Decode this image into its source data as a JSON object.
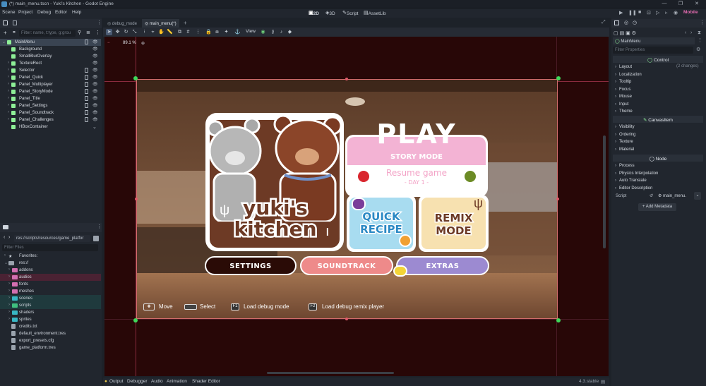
{
  "titlebar": {
    "title": "(*) main_menu.tscn - Yuki's Kitchen - Godot Engine",
    "controls": [
      "—",
      "❐",
      "✕"
    ]
  },
  "menus": [
    "Scene",
    "Project",
    "Debug",
    "Editor",
    "Help"
  ],
  "workspaces": {
    "w2d": "2D",
    "w3d": "3D",
    "script": "Script",
    "assetlib": "AssetLib"
  },
  "renderer": "Mobile",
  "scene_dock": {
    "filter_placeholder": "Filter: name, t:type, g:grou",
    "nodes": [
      {
        "name": "MainMenu",
        "color": "#8eef97"
      },
      {
        "name": "Background",
        "color": "#8eef97"
      },
      {
        "name": "SmallBlurOverlay",
        "color": "#8eef97"
      },
      {
        "name": "TextureRect",
        "color": "#8eef97"
      },
      {
        "name": "Selector",
        "color": "#8eef97"
      },
      {
        "name": "Panel_Quick",
        "color": "#8eef97"
      },
      {
        "name": "Panel_Multiplayer",
        "color": "#8eef97"
      },
      {
        "name": "Panel_StoryMode",
        "color": "#8eef97"
      },
      {
        "name": "Panel_Title",
        "color": "#8eef97"
      },
      {
        "name": "Panel_Settings",
        "color": "#8eef97"
      },
      {
        "name": "Panel_Soundtrack",
        "color": "#8eef97"
      },
      {
        "name": "Panel_Challenges",
        "color": "#8eef97"
      },
      {
        "name": "HBoxContainer",
        "color": "#8eef97"
      }
    ]
  },
  "filesystem": {
    "path": "res://scripts/resources/game_platfor",
    "filter_placeholder": "Filter Files",
    "favorites": "Favorites:",
    "root": "res://",
    "folders": [
      {
        "name": "addons",
        "color": "#d46fb1"
      },
      {
        "name": "audios",
        "color": "#d46fb1"
      },
      {
        "name": "fonts",
        "color": "#d46fb1"
      },
      {
        "name": "meshes",
        "color": "#d46fb1"
      },
      {
        "name": "scenes",
        "color": "#38b6c4"
      },
      {
        "name": "scripts",
        "color": "#3fbf7f"
      },
      {
        "name": "shaders",
        "color": "#38b6c4"
      },
      {
        "name": "sprites",
        "color": "#38b6c4"
      }
    ],
    "files": [
      "credits.txt",
      "default_environment.tres",
      "export_presets.cfg",
      "game_platform.tres"
    ]
  },
  "tabs": [
    "debug_mode",
    "main_menu(*)"
  ],
  "viewport": {
    "zoom": "89.1 %",
    "view_menu": "View"
  },
  "game": {
    "logo_line1": "yuki's",
    "logo_line2": "kitchen",
    "play": "PLAY",
    "story_mode": "STORY MODE",
    "resume": "Resume game",
    "day": "- DAY 1 -",
    "quick": "QUICK",
    "recipe": "RECIPE",
    "remix": "REMIX",
    "mode": "MODE",
    "settings": "SETTINGS",
    "soundtrack": "SOUNDTRACK",
    "extras": "EXTRAS",
    "hints": [
      {
        "key": "",
        "label": "Move"
      },
      {
        "key": "",
        "label": "Select"
      },
      {
        "key": "F1",
        "label": "Load debug mode"
      },
      {
        "key": "F2",
        "label": "Load debug remix player"
      }
    ]
  },
  "bottom": {
    "tabs": [
      "Output",
      "Debugger",
      "Audio",
      "Animation",
      "Shader Editor"
    ],
    "version": "4.3.stable"
  },
  "inspector": {
    "node": "MainMenu",
    "filter_placeholder": "Filter Properties",
    "control": "Control",
    "control_sections": [
      "Layout",
      "Localization",
      "Tooltip",
      "Focus",
      "Mouse",
      "Input",
      "Theme"
    ],
    "layout_changes": "(2 changes)",
    "canvasitem": "CanvasItem",
    "canvas_sections": [
      "Visibility",
      "Ordering",
      "Texture",
      "Material"
    ],
    "node_cat": "Node",
    "node_sections": [
      "Process",
      "Physics Interpolation",
      "Auto Translate",
      "Editor Description"
    ],
    "script_label": "Script",
    "script_value": "main_menu.",
    "add_metadata": "+ Add Metadata"
  }
}
